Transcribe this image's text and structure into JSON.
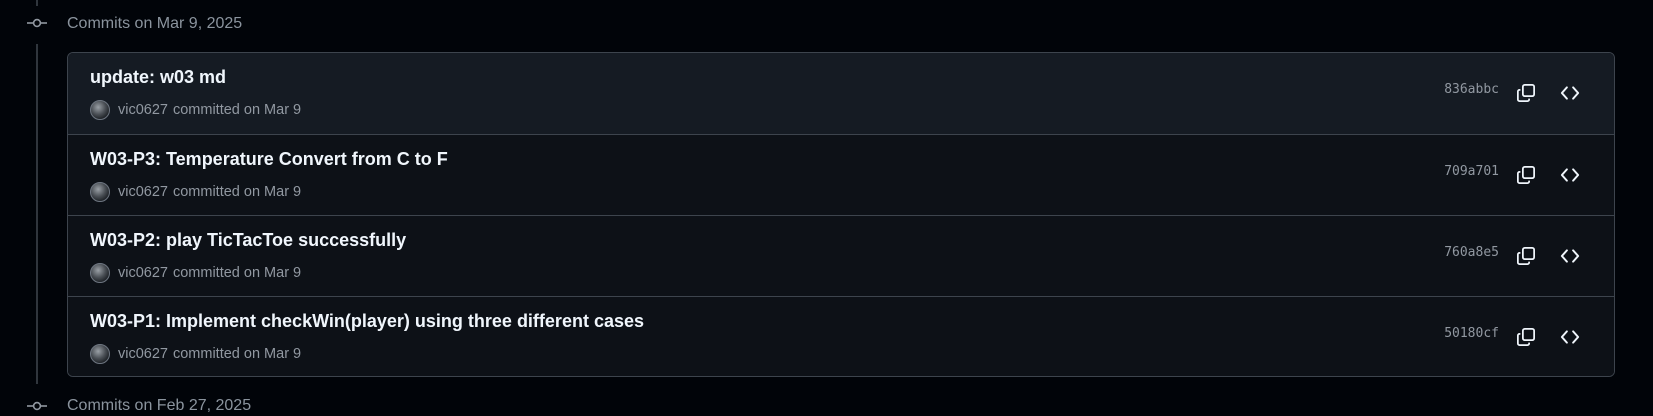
{
  "groups": [
    {
      "header": "Commits on Mar 9, 2025",
      "commits": [
        {
          "title": "update: w03 md",
          "author": "vic0627",
          "when": "committed on Mar 9",
          "sha": "836abbc"
        },
        {
          "title": "W03-P3: Temperature Convert from C to F",
          "author": "vic0627",
          "when": "committed on Mar 9",
          "sha": "709a701"
        },
        {
          "title": "W03-P2: play TicTacToe successfully",
          "author": "vic0627",
          "when": "committed on Mar 9",
          "sha": "760a8e5"
        },
        {
          "title": "W03-P1: Implement checkWin(player) using three different cases",
          "author": "vic0627",
          "when": "committed on Mar 9",
          "sha": "50180cf"
        }
      ]
    },
    {
      "header": "Commits on Feb 27, 2025"
    }
  ],
  "icons": {
    "timeline": "git-commit-icon",
    "copy": "copy-icon",
    "browse": "code-icon"
  },
  "colors": {
    "background": "#010409",
    "row_highlight": "#151b23",
    "border": "#3d444d",
    "title": "#f0f6fc",
    "muted": "#9198a1"
  }
}
